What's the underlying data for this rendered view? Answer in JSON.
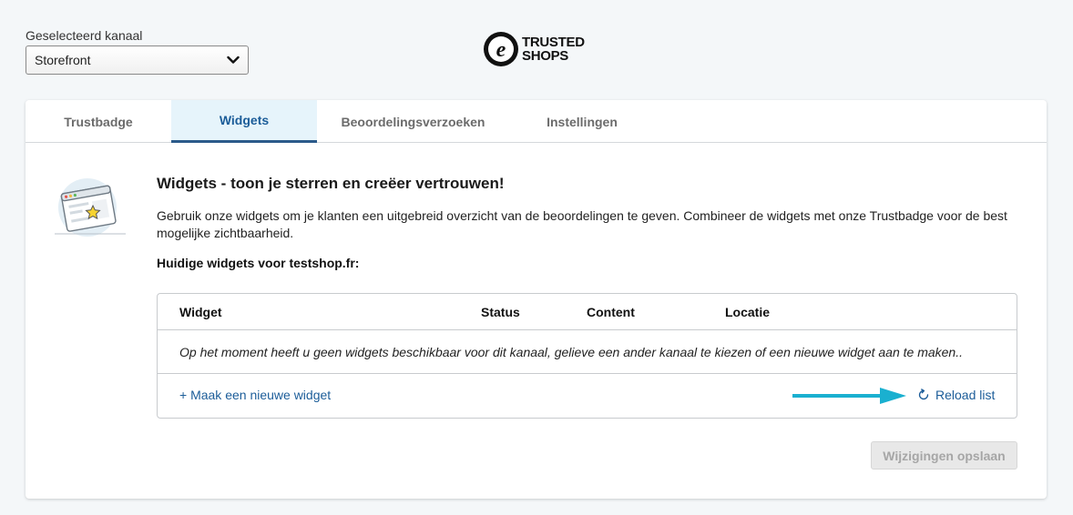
{
  "channel": {
    "label": "Geselecteerd kanaal",
    "selected": "Storefront"
  },
  "logo": {
    "line1": "TRUSTED",
    "line2": "SHOPS"
  },
  "tabs": [
    {
      "label": "Trustbadge",
      "active": false
    },
    {
      "label": "Widgets",
      "active": true
    },
    {
      "label": "Beoordelingsverzoeken",
      "active": false
    },
    {
      "label": "Instellingen",
      "active": false
    }
  ],
  "content": {
    "title": "Widgets - toon je sterren en creëer vertrouwen!",
    "description": "Gebruik onze widgets om je klanten een uitgebreid overzicht van de beoordelingen te geven. Combineer de widgets met onze Trustbadge voor de best mogelijke zichtbaarheid.",
    "subheading": "Huidige widgets voor testshop.fr:"
  },
  "table": {
    "columns": [
      "Widget",
      "Status",
      "Content",
      "Locatie"
    ],
    "empty_message": "Op het moment heeft u geen widgets beschikbaar voor dit kanaal, gelieve een ander kanaal te kiezen of een nieuwe widget aan te maken..",
    "new_widget_link": "+ Maak een nieuwe widget",
    "reload_link": "Reload list"
  },
  "save_button": "Wijzigingen opslaan",
  "colors": {
    "accent": "#1c5d99",
    "active_tab_bg": "#e6f4fb",
    "arrow": "#1ab0d0"
  }
}
